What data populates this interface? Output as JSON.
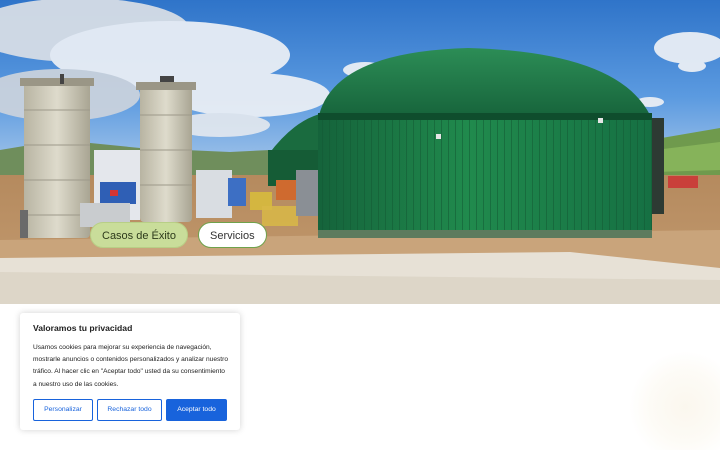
{
  "hero": {
    "image_alt": "biogas plant with green domed digester tank",
    "buttons": [
      {
        "label": "Casos de Éxito"
      },
      {
        "label": "Servicios"
      }
    ]
  },
  "cookie_banner": {
    "title": "Valoramos tu privacidad",
    "text": "Usamos cookies para mejorar su experiencia de navegación, mostrarle anuncios o contenidos personalizados y analizar nuestro tráfico. Al hacer clic en \"Aceptar todo\" usted da su consentimiento a nuestro uso de las cookies.",
    "customize_label": "Personalizar",
    "reject_label": "Rechazar todo",
    "accept_label": "Aceptar todo"
  },
  "colors": {
    "accent_blue": "#1863dc",
    "pill_green": "#c9dd9a",
    "pill_border_green": "#6fa24b",
    "tank_green": "#1e7a44"
  }
}
